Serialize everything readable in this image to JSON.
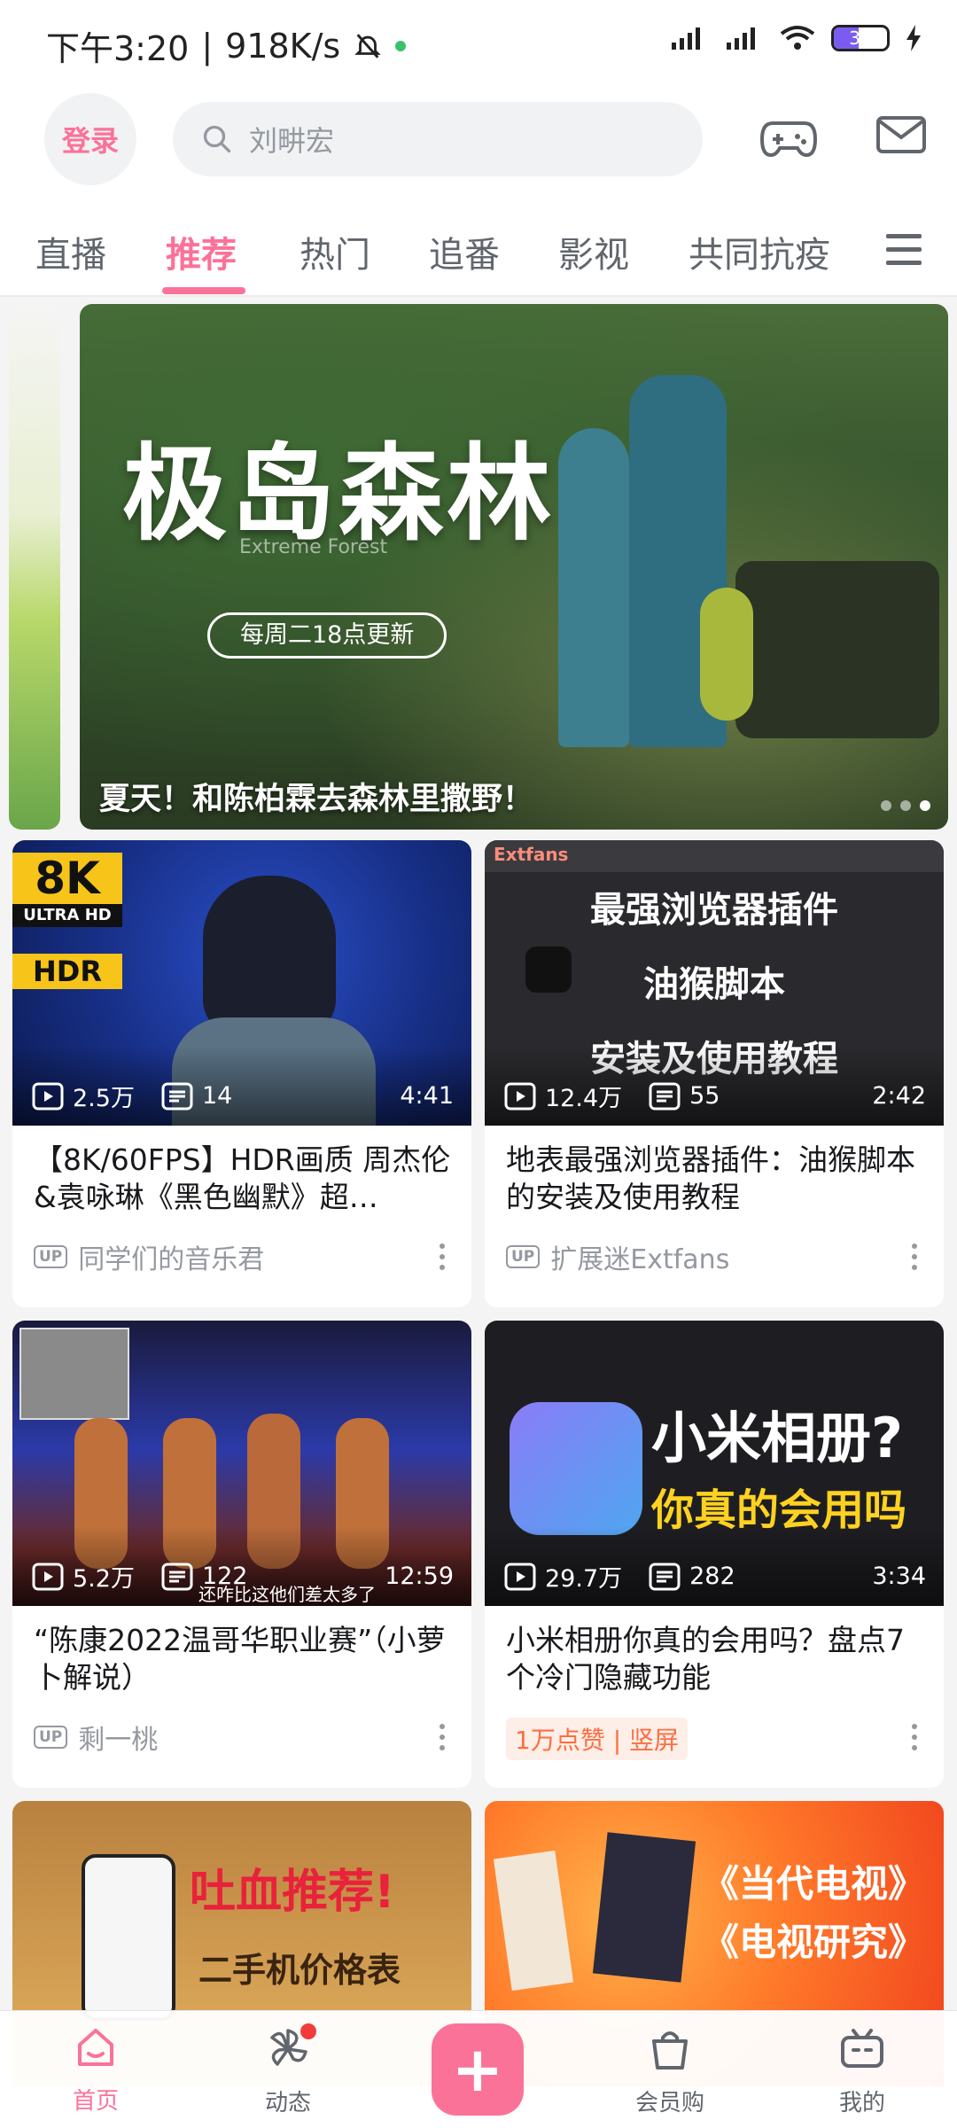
{
  "status_bar": {
    "time": "下午3:20",
    "speed": "918K/s",
    "battery": "31"
  },
  "header": {
    "login_label": "登录",
    "search_placeholder": "刘畊宏"
  },
  "tabs": [
    {
      "label": "直播"
    },
    {
      "label": "推荐"
    },
    {
      "label": "热门"
    },
    {
      "label": "追番"
    },
    {
      "label": "影视"
    },
    {
      "label": "共同抗疫"
    }
  ],
  "banner": {
    "title": "极岛森林",
    "subtitle": "Extreme Forest",
    "pill": "每周二18点更新",
    "caption": "夏天！和陈柏霖去森林里撒野！"
  },
  "cards": [
    {
      "overlay": {
        "badge_top": "8K",
        "badge_mid": "ULTRA HD",
        "badge_bot": "HDR"
      },
      "views": "2.5万",
      "danmaku": "14",
      "duration": "4:41",
      "title": "【8K/60FPS】HDR画质 周杰伦&袁咏琳《黑色幽默》超…",
      "uploader": "同学们的音乐君"
    },
    {
      "overlay": {
        "line1": "最强浏览器插件",
        "line2": "油猴脚本",
        "line3": "安装及使用教程",
        "brand": "Extfans"
      },
      "views": "12.4万",
      "danmaku": "55",
      "duration": "2:42",
      "title": "地表最强浏览器插件：油猴脚本的安装及使用教程",
      "uploader": "扩展迷Extfans"
    },
    {
      "overlay": {
        "subtitle": "还咋比这他们差太多了"
      },
      "views": "5.2万",
      "danmaku": "122",
      "duration": "12:59",
      "title": "“陈康2022温哥华职业赛”（小萝卜解说）",
      "uploader": "剩一桃"
    },
    {
      "overlay": {
        "line1": "小米相册?",
        "line2": "你真的会用吗"
      },
      "views": "29.7万",
      "danmaku": "282",
      "duration": "3:34",
      "title": "小米相册你真的会用吗？盘点7个冷门隐藏功能",
      "tag": "1万点赞 | 竖屏"
    },
    {
      "overlay": {
        "line1": "吐血推荐!",
        "line2": "二手机价格表"
      }
    },
    {
      "overlay": {
        "line1": "《当代电视》",
        "line2": "《电视研究》"
      }
    }
  ],
  "bottom_nav": [
    {
      "label": "首页"
    },
    {
      "label": "动态"
    },
    {
      "label": "会员购"
    },
    {
      "label": "我的"
    }
  ],
  "colors": {
    "accent": "#fb7299",
    "text": "#18191c",
    "muted": "#9499a0"
  }
}
